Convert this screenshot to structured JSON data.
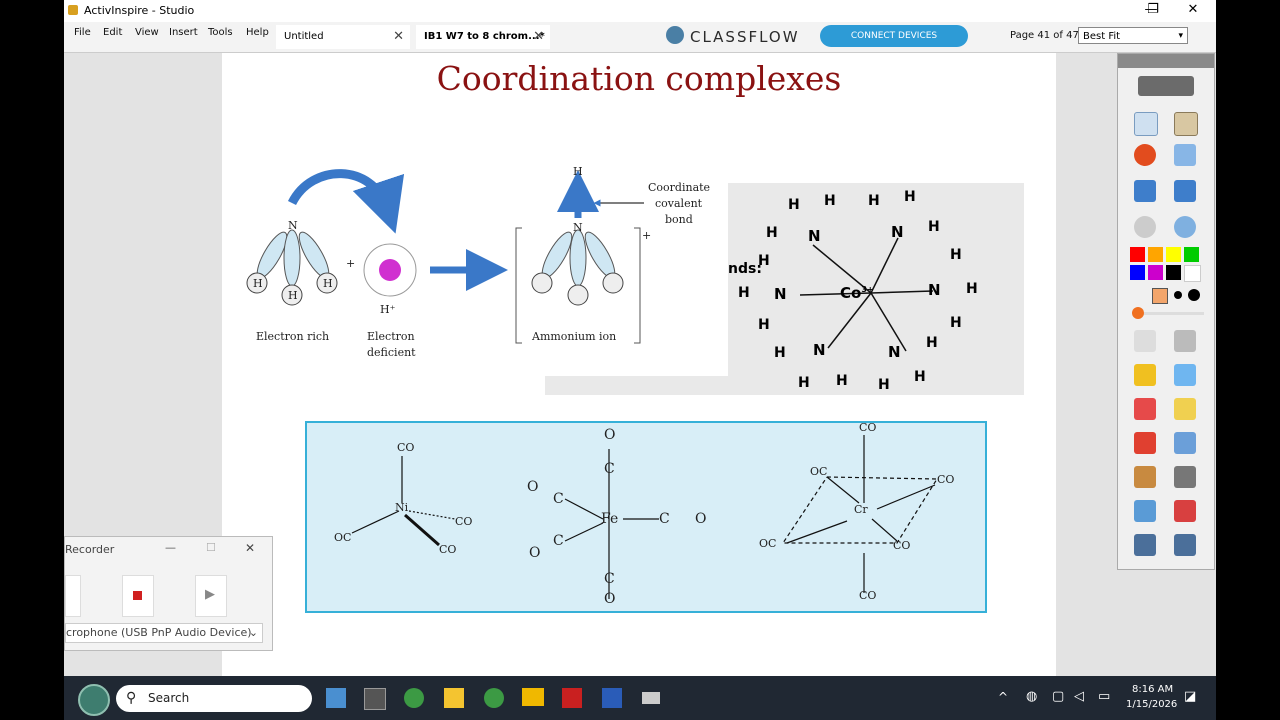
{
  "window": {
    "title": "ActivInspire - Studio",
    "controls": [
      "—",
      "❐",
      "✕"
    ]
  },
  "menu": [
    "File",
    "Edit",
    "View",
    "Insert",
    "Tools",
    "Help"
  ],
  "tabs": [
    {
      "label": "Untitled",
      "active": false
    },
    {
      "label": "IB1 W7 to 8 chrom...*",
      "active": true
    }
  ],
  "classflow": {
    "brand": "CLASSFLOW",
    "connect_label": "CONNECT DEVICES"
  },
  "page_info": {
    "label": "Page 41 of 47",
    "zoom": "Best Fit"
  },
  "slide": {
    "title": "Coordination complexes",
    "ammonia": {
      "label_n": "N",
      "label_h": "H",
      "plus": "+",
      "h_plus": "H⁺",
      "electron_rich": "Electron rich",
      "electron_deficient_1": "Electron",
      "electron_deficient_2": "deficient",
      "ammonium": "Ammonium ion",
      "coord1": "Coordinate",
      "coord2": "covalent",
      "coord3": "bond",
      "charge": "+"
    },
    "cobalt": {
      "center": "Co",
      "charge": "3+",
      "partial_label": "nds:",
      "n": "N",
      "h": "H"
    },
    "carbonyls": {
      "ni": {
        "metal": "Ni",
        "ligand": "CO",
        "ligand_left": "OC"
      },
      "fe": {
        "metal": "Fe",
        "o": "O",
        "c": "C"
      },
      "cr": {
        "metal": "Cr",
        "ligand": "CO",
        "ligand_left": "OC"
      }
    }
  },
  "toolbox": {
    "colors": [
      "#ff0000",
      "#ffa500",
      "#ffff00",
      "#00cc00",
      "#0000ff",
      "#cc00cc",
      "#000000",
      "#ffffff"
    ]
  },
  "recorder": {
    "title": "Recorder",
    "device": "crophone (USB PnP Audio Device)"
  },
  "taskbar": {
    "search_placeholder": "Search",
    "time": "8:16 AM",
    "date": "1/15/2026"
  }
}
